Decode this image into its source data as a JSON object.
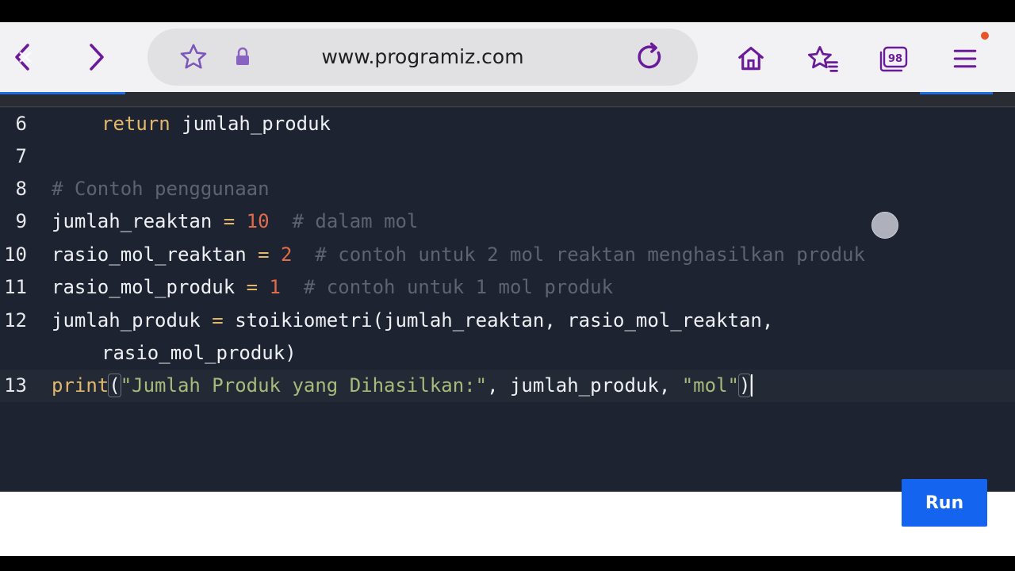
{
  "browser": {
    "url": "www.programiz.com",
    "tabs_count": "98"
  },
  "editor": {
    "lines": [
      {
        "num": "6",
        "indent": true,
        "tokens": [
          {
            "t": "return",
            "c": "kw"
          },
          {
            "t": " jumlah_produk",
            "c": ""
          }
        ]
      },
      {
        "num": "7",
        "indent": false,
        "tokens": []
      },
      {
        "num": "8",
        "indent": false,
        "tokens": [
          {
            "t": "# Contoh penggunaan",
            "c": "cm"
          }
        ]
      },
      {
        "num": "9",
        "indent": false,
        "tokens": [
          {
            "t": "jumlah_reaktan ",
            "c": ""
          },
          {
            "t": "=",
            "c": "op"
          },
          {
            "t": " ",
            "c": ""
          },
          {
            "t": "10",
            "c": "num"
          },
          {
            "t": "  ",
            "c": ""
          },
          {
            "t": "# dalam mol",
            "c": "cm"
          }
        ]
      },
      {
        "num": "10",
        "indent": false,
        "tokens": [
          {
            "t": "rasio_mol_reaktan ",
            "c": ""
          },
          {
            "t": "=",
            "c": "op"
          },
          {
            "t": " ",
            "c": ""
          },
          {
            "t": "2",
            "c": "num"
          },
          {
            "t": "  ",
            "c": ""
          },
          {
            "t": "# contoh untuk 2 mol reaktan menghasilkan produk",
            "c": "cm"
          }
        ]
      },
      {
        "num": "11",
        "indent": false,
        "tokens": [
          {
            "t": "rasio_mol_produk ",
            "c": ""
          },
          {
            "t": "=",
            "c": "op"
          },
          {
            "t": " ",
            "c": ""
          },
          {
            "t": "1",
            "c": "num"
          },
          {
            "t": "  ",
            "c": ""
          },
          {
            "t": "# contoh untuk 1 mol produk",
            "c": "cm"
          }
        ]
      },
      {
        "num": "12",
        "indent": false,
        "tokens": [
          {
            "t": "jumlah_produk ",
            "c": ""
          },
          {
            "t": "=",
            "c": "op"
          },
          {
            "t": " stoikiometri(jumlah_reaktan, rasio_mol_reaktan,",
            "c": ""
          }
        ]
      },
      {
        "num": "",
        "indent": true,
        "tokens": [
          {
            "t": "rasio_mol_produk)",
            "c": ""
          }
        ]
      },
      {
        "num": "13",
        "indent": false,
        "active": true,
        "tokens": [
          {
            "t": "print",
            "c": "kw"
          },
          {
            "t": "(",
            "c": "paren"
          },
          {
            "t": "\"Jumlah Produk yang Dihasilkan:\"",
            "c": "str"
          },
          {
            "t": ", jumlah_produk, ",
            "c": ""
          },
          {
            "t": "\"mol\"",
            "c": "str"
          },
          {
            "t": ")",
            "c": "paren"
          }
        ]
      }
    ]
  },
  "run_label": "Run",
  "colors": {
    "accent": "#1464f0",
    "editor_bg": "#1d2330",
    "icon_purple": "#6a1b9a"
  }
}
